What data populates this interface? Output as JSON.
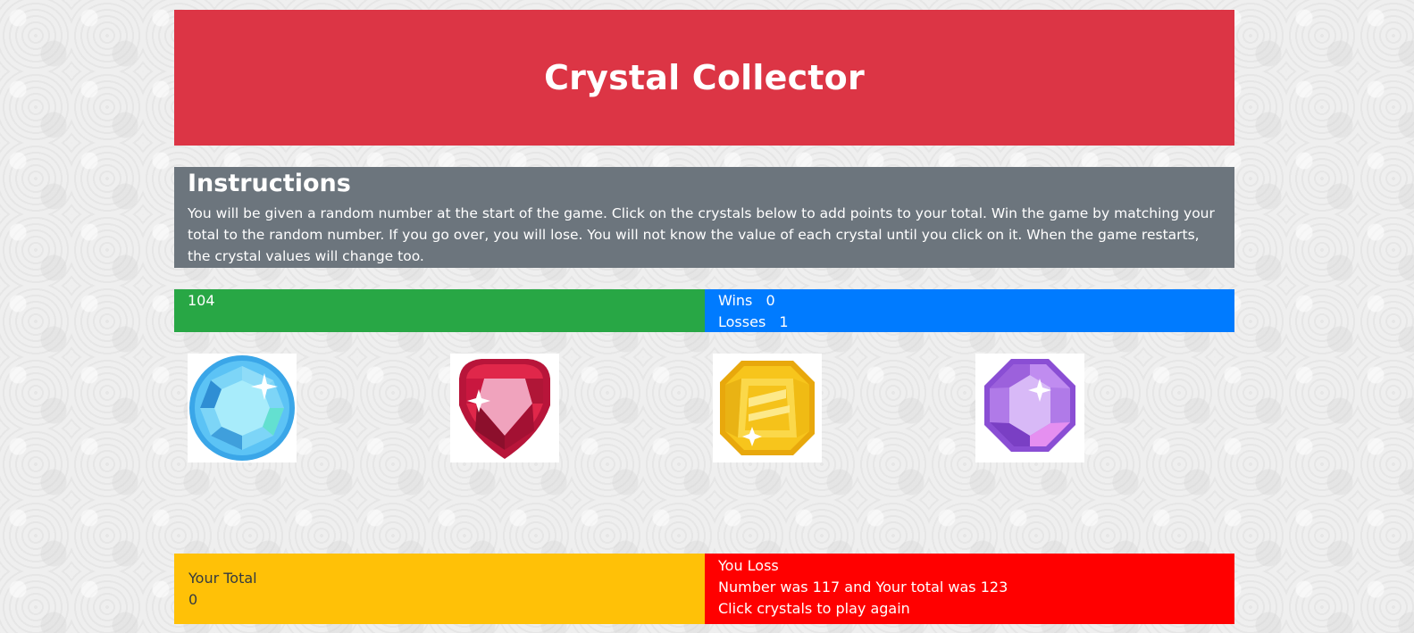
{
  "header": {
    "title": "Crystal Collector"
  },
  "instructions": {
    "heading": "Instructions",
    "text": "You will be given a random number at the start of the game. Click on the crystals below to add points to your total. Win the game by matching your total to the random number. If you go over, you will lose. You will not know the value of each crystal until you click on it. When the game restarts, the crystal values will change too."
  },
  "target_number": "104",
  "score": {
    "wins_label": "Wins",
    "wins_value": "0",
    "losses_label": "Losses",
    "losses_value": "1"
  },
  "crystals": [
    {
      "name": "blue-crystal",
      "color": "#4fb8f0"
    },
    {
      "name": "red-crystal",
      "color": "#e0274a"
    },
    {
      "name": "yellow-crystal",
      "color": "#f7c51c"
    },
    {
      "name": "purple-crystal",
      "color": "#a868e0"
    }
  ],
  "total": {
    "label": "Your Total",
    "value": "0"
  },
  "result": {
    "line1": "You Loss",
    "line2": "Number was 117 and Your total was 123",
    "line3": "Click crystals to play again"
  },
  "colors": {
    "header": "#dc3545",
    "instructions": "#6c757d",
    "target": "#28a745",
    "score": "#007bff",
    "total": "#ffc107",
    "result": "#ff0000"
  }
}
